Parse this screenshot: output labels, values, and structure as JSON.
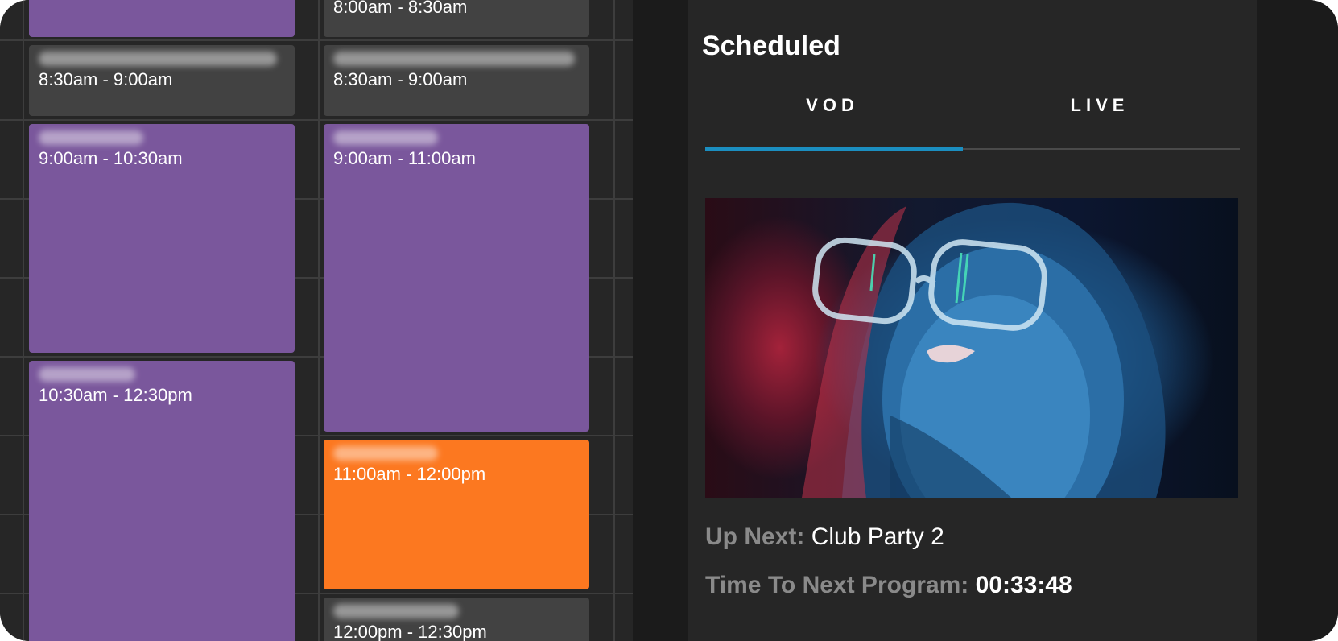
{
  "schedule": {
    "events": [
      {
        "id": "e0",
        "color": "purple",
        "title_blurred": true,
        "time": ""
      },
      {
        "id": "e1",
        "color": "gray",
        "title_blurred": true,
        "time": "8:00am - 8:30am"
      },
      {
        "id": "e2",
        "color": "gray",
        "title_blurred": true,
        "time": "8:30am - 9:00am"
      },
      {
        "id": "e3",
        "color": "gray",
        "title_blurred": true,
        "time": "8:30am - 9:00am"
      },
      {
        "id": "e4",
        "color": "purple",
        "title_blurred": true,
        "time": "9:00am - 10:30am"
      },
      {
        "id": "e5",
        "color": "purple",
        "title_blurred": true,
        "time": "9:00am - 11:00am"
      },
      {
        "id": "e6",
        "color": "purple",
        "title_blurred": true,
        "time": "10:30am - 12:30pm"
      },
      {
        "id": "e7",
        "color": "orange",
        "title_blurred": true,
        "time": "11:00am - 12:00pm"
      },
      {
        "id": "e8",
        "color": "gray",
        "title_blurred": true,
        "time": "12:00pm - 12:30pm"
      }
    ],
    "colors": {
      "purple": "#7a579c",
      "gray": "#424242",
      "orange": "#fc7820",
      "grid_bg": "#262626"
    }
  },
  "panel": {
    "title": "Scheduled",
    "tabs": [
      {
        "label": "VOD",
        "active": true
      },
      {
        "label": "LIVE",
        "active": false
      }
    ],
    "accent": "#1b8ec0",
    "thumbnail_icon": "video-thumbnail",
    "up_next_label": "Up Next:",
    "up_next_value": "Club Party 2",
    "time_to_next_label": "Time To Next Program:",
    "time_to_next_value": "00:33:48"
  }
}
